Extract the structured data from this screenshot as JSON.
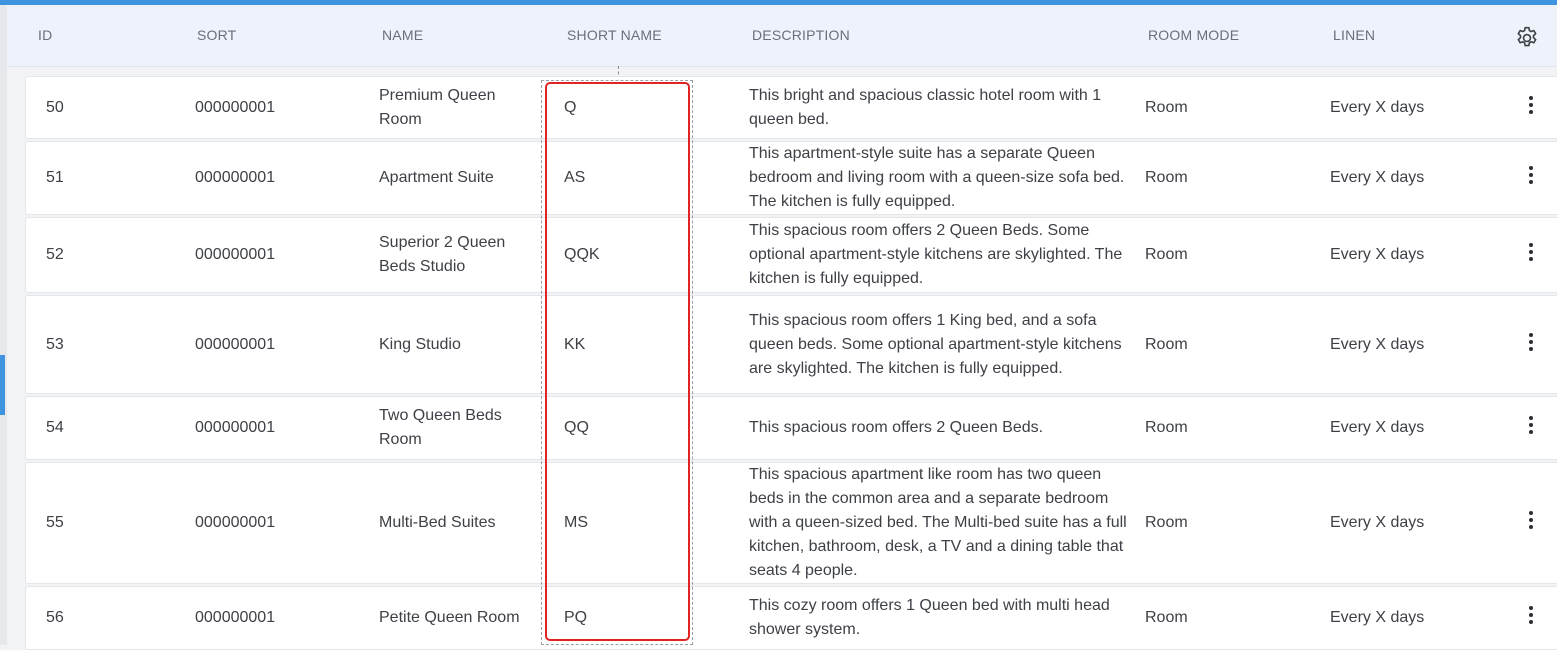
{
  "header": {
    "columns": [
      "ID",
      "SORT",
      "NAME",
      "SHORT NAME",
      "DESCRIPTION",
      "ROOM MODE",
      "LINEN"
    ],
    "settings_icon": "gear-icon"
  },
  "rows": [
    {
      "id": "50",
      "sort": "000000001",
      "name": "Premium Queen Room",
      "short": "Q",
      "desc": "This bright and spacious classic hotel room with 1 queen bed.",
      "mode": "Room",
      "linen": "Every X days"
    },
    {
      "id": "51",
      "sort": "000000001",
      "name": "Apartment Suite",
      "short": "AS",
      "desc": "This apartment-style suite has a separate Queen bedroom and living room with a queen-size sofa bed. The kitchen is fully equipped.",
      "mode": "Room",
      "linen": "Every X days"
    },
    {
      "id": "52",
      "sort": "000000001",
      "name": "Superior 2 Queen Beds Studio",
      "short": "QQK",
      "desc": "This spacious room offers 2 Queen Beds. Some optional apartment-style kitchens are skylighted. The kitchen is fully equipped.",
      "mode": "Room",
      "linen": "Every X days"
    },
    {
      "id": "53",
      "sort": "000000001",
      "name": "King Studio",
      "short": "KK",
      "desc": "This spacious room offers 1 King bed, and a sofa queen beds. Some optional apartment-style kitchens are skylighted. The kitchen is fully equipped.",
      "mode": "Room",
      "linen": "Every X days"
    },
    {
      "id": "54",
      "sort": "000000001",
      "name": "Two Queen Beds Room",
      "short": "QQ",
      "desc": "This spacious room offers 2 Queen Beds.",
      "mode": "Room",
      "linen": "Every X days"
    },
    {
      "id": "55",
      "sort": "000000001",
      "name": "Multi-Bed Suites",
      "short": "MS",
      "desc": "This spacious apartment like room has two queen beds in the common area and a separate bedroom with a queen-sized bed. The Multi-bed suite has a full kitchen, bathroom, desk, a TV and a dining table that seats 4 people.",
      "mode": "Room",
      "linen": "Every X days"
    },
    {
      "id": "56",
      "sort": "000000001",
      "name": "Petite Queen Room",
      "short": "PQ",
      "desc": "This cozy room offers 1 Queen bed with multi head shower system.",
      "mode": "Room",
      "linen": "Every X days"
    }
  ],
  "colors": {
    "accent": "#3f94e0",
    "highlight": "#e02424",
    "header_bg": "#eef2fb"
  }
}
